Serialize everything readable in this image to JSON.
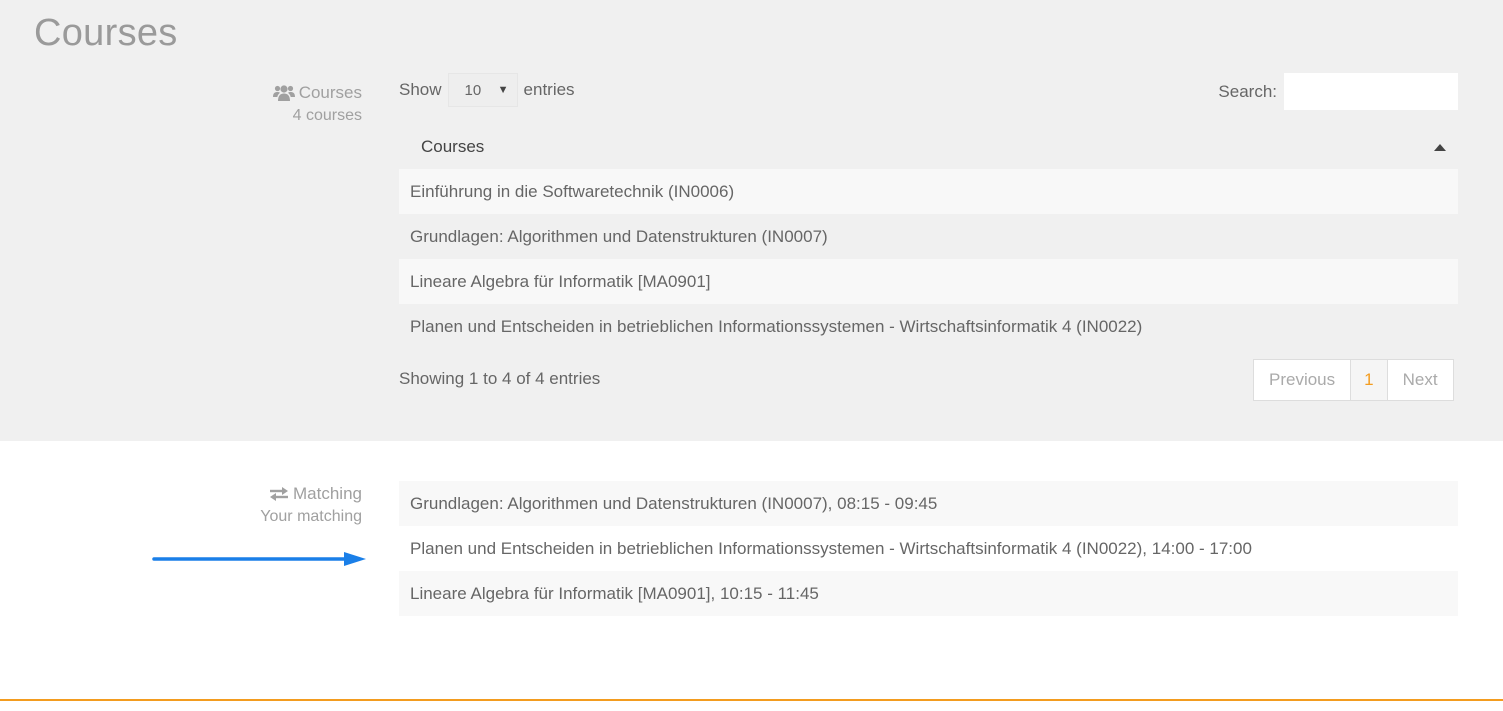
{
  "page": {
    "title": "Courses"
  },
  "courses_panel": {
    "label_icon": "users-icon",
    "label": "Courses",
    "sublabel": "4 courses"
  },
  "table": {
    "length": {
      "prefix": "Show",
      "selected": "10",
      "suffix": "entries"
    },
    "search": {
      "label": "Search:",
      "value": "",
      "placeholder": ""
    },
    "columns": [
      {
        "label": "Courses",
        "sort": "ascending"
      }
    ],
    "rows": [
      "Einführung in die Softwaretechnik (IN0006)",
      "Grundlagen: Algorithmen und Datenstrukturen (IN0007)",
      "Lineare Algebra für Informatik [MA0901]",
      "Planen und Entscheiden in betrieblichen Informationssystemen - Wirtschaftsinformatik 4 (IN0022)"
    ],
    "info": "Showing 1 to 4 of 4 entries",
    "pagination": {
      "previous": "Previous",
      "current": "1",
      "next": "Next"
    }
  },
  "matching_panel": {
    "label_icon": "exchange-icon",
    "label": "Matching",
    "sublabel": "Your matching",
    "items": [
      "Grundlagen: Algorithmen und Datenstrukturen (IN0007), 08:15 - 09:45",
      "Planen und Entscheiden in betrieblichen Informationssystemen - Wirtschaftsinformatik 4 (IN0022), 14:00 - 17:00",
      "Lineare Algebra für Informatik [MA0901], 10:15 - 11:45"
    ]
  },
  "colors": {
    "accent": "#f39c1f",
    "arrow": "#1a7fe8",
    "panel_bg": "#f0f0f0"
  }
}
